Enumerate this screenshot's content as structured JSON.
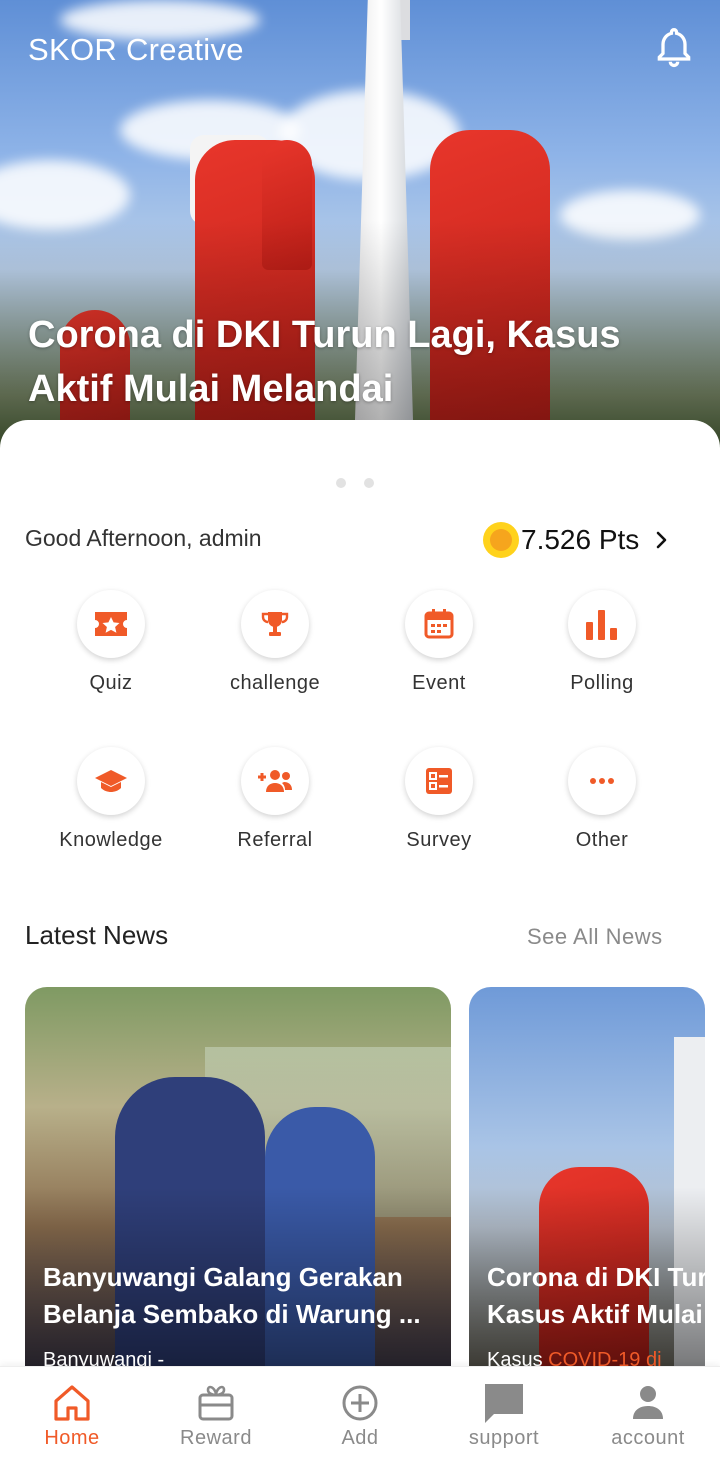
{
  "header": {
    "app_title": "SKOR Creative",
    "notification_icon": "bell-icon"
  },
  "hero": {
    "headline": "Corona di DKI Turun Lagi, Kasus Aktif Mulai Melandai",
    "slides": 2
  },
  "greeting": {
    "text": "Good Afternoon, admin",
    "points": "7.526 Pts",
    "coin_icon": "coin-icon"
  },
  "menu": [
    {
      "label": "Quiz",
      "icon": "quiz-ticket-icon"
    },
    {
      "label": "challenge",
      "icon": "trophy-icon"
    },
    {
      "label": "Event",
      "icon": "calendar-icon"
    },
    {
      "label": "Polling",
      "icon": "bar-chart-icon"
    },
    {
      "label": "Knowledge",
      "icon": "graduation-cap-icon"
    },
    {
      "label": "Referral",
      "icon": "add-people-icon"
    },
    {
      "label": "Survey",
      "icon": "survey-list-icon"
    },
    {
      "label": "Other",
      "icon": "more-dots-icon"
    }
  ],
  "news": {
    "section_title": "Latest News",
    "see_all": "See All News",
    "items": [
      {
        "title_line1": "Banyuwangi Galang Gerakan",
        "title_line2": "Belanja Sembako di Warung ...",
        "snippet": "Banyuwangi -"
      },
      {
        "title_line1": "Corona di DKI Tur",
        "title_line2": "Kasus Aktif Mulai",
        "snippet_prefix": "Kasus ",
        "snippet_highlight": "COVID-19 di"
      }
    ]
  },
  "bottom_nav": [
    {
      "label": "Home",
      "icon": "home-icon",
      "active": true
    },
    {
      "label": "Reward",
      "icon": "gift-card-icon",
      "active": false
    },
    {
      "label": "Add",
      "icon": "add-circle-icon",
      "active": false
    },
    {
      "label": "support",
      "icon": "chat-bubble-icon",
      "active": false
    },
    {
      "label": "account",
      "icon": "person-icon",
      "active": false
    }
  ],
  "colors": {
    "accent": "#f05a28",
    "coin": "#ffd21c",
    "muted_text": "#8a8a8a"
  }
}
